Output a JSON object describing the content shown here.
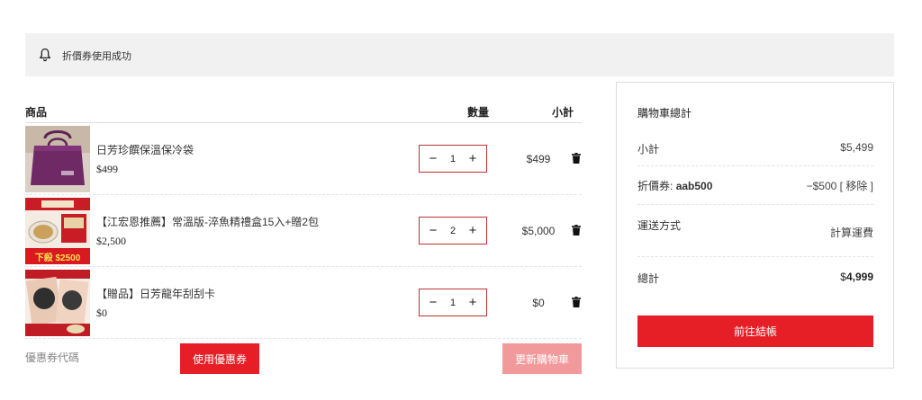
{
  "notice": {
    "message": "折價券使用成功"
  },
  "cart": {
    "headers": {
      "product": "商品",
      "quantity": "數量",
      "subtotal": "小計"
    },
    "items": [
      {
        "name": "日芳珍饌保溫保冷袋",
        "price": "$499",
        "quantity": "1",
        "subtotal": "$499"
      },
      {
        "name": "【江宏恩推薦】常溫版-淬魚精禮盒15入+贈2包",
        "price": "$2,500",
        "quantity": "2",
        "subtotal": "$5,000"
      },
      {
        "name": "【贈品】日芳龍年刮刮卡",
        "price": "$0",
        "quantity": "1",
        "subtotal": "$0"
      }
    ],
    "minus_label": "−",
    "plus_label": "+"
  },
  "coupon": {
    "placeholder": "優惠券代碼",
    "apply_label": "使用優惠券",
    "update_label": "更新購物車"
  },
  "thumb_text": {
    "item2_banner": "下殺 $2500"
  },
  "totals": {
    "title": "購物車總計",
    "subtotal_label": "小計",
    "subtotal_value": "$5,499",
    "coupon_label": "折價券:",
    "coupon_code": "aab500",
    "coupon_value": "−$500",
    "remove_label": "[ 移除 ]",
    "shipping_label": "運送方式",
    "shipping_value": "計算運費",
    "total_label": "總計",
    "total_currency": "$",
    "total_value": "4,999",
    "checkout_label": "前往結帳"
  },
  "colors": {
    "accent": "#e61f26",
    "accent_light": "#f2999c",
    "notice_bg": "#f1f1f1",
    "qty_border": "#bb3333"
  }
}
